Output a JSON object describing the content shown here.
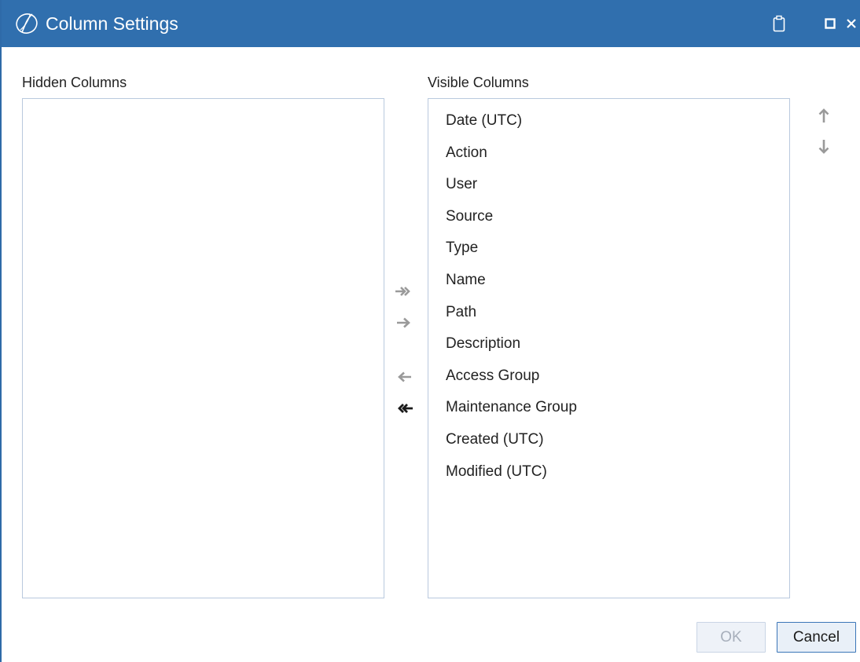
{
  "window": {
    "title": "Column Settings",
    "title_bar_color": "#306fae"
  },
  "hidden_columns": {
    "label": "Hidden Columns",
    "items": []
  },
  "visible_columns": {
    "label": "Visible Columns",
    "items": [
      "Date (UTC)",
      "Action",
      "User",
      "Source",
      "Type",
      "Name",
      "Path",
      "Description",
      "Access Group",
      "Maintenance Group",
      "Created (UTC)",
      "Modified (UTC)"
    ]
  },
  "movers": {
    "add_all_icon": "double-arrow-right-icon",
    "add_icon": "arrow-right-icon",
    "remove_icon": "arrow-left-icon",
    "remove_all_icon": "double-arrow-left-icon"
  },
  "order": {
    "up_icon": "arrow-up-icon",
    "down_icon": "arrow-down-icon"
  },
  "buttons": {
    "ok_label": "OK",
    "cancel_label": "Cancel"
  }
}
